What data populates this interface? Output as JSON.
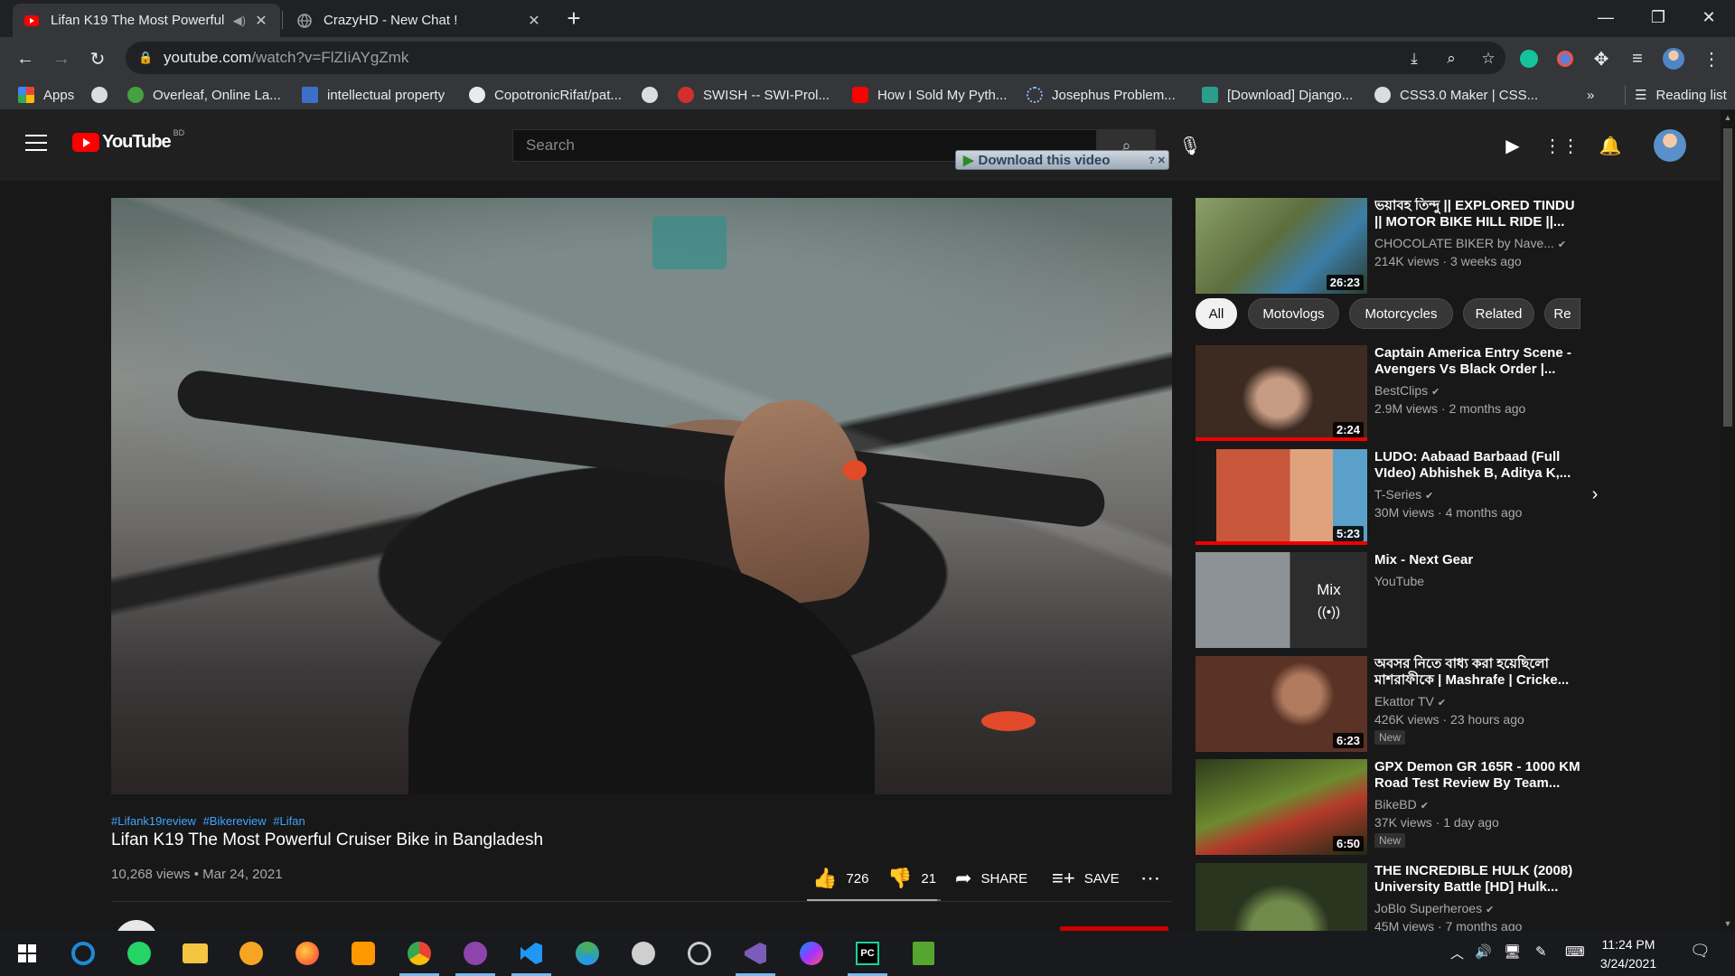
{
  "browser": {
    "tabs": [
      {
        "title": "Lifan K19 The Most Powerful",
        "active": true,
        "favicon": "youtube-icon"
      },
      {
        "title": "CrazyHD - New Chat !",
        "active": false,
        "favicon": "globe-icon"
      }
    ],
    "url_host": "youtube.com",
    "url_path": "/watch?v=FlZIiAYgZmk",
    "bookmarks": [
      {
        "label": "Apps",
        "icon": "apps-grid-icon",
        "color": "#4285f4"
      },
      {
        "label": "",
        "icon": "globe-icon",
        "color": "#9aa0a6"
      },
      {
        "label": "Overleaf, Online La...",
        "icon": "overleaf-icon",
        "color": "#47a141"
      },
      {
        "label": "intellectual property",
        "icon": "document-icon",
        "color": "#3b6fc9"
      },
      {
        "label": "CopotronicRifat/pat...",
        "icon": "github-icon",
        "color": "#e8eaed"
      },
      {
        "label": "",
        "icon": "globe-icon",
        "color": "#9aa0a6"
      },
      {
        "label": "SWISH -- SWI-Prol...",
        "icon": "swish-icon",
        "color": "#d32f2f"
      },
      {
        "label": "How I Sold My Pyth...",
        "icon": "youtube-icon",
        "color": "#ff0000"
      },
      {
        "label": "Josephus Problem...",
        "icon": "loading-icon",
        "color": "#8ab4f8"
      },
      {
        "label": "[Download] Django...",
        "icon": "django-icon",
        "color": "#2a9d8f"
      },
      {
        "label": "CSS3.0 Maker | CSS...",
        "icon": "globe-icon",
        "color": "#9aa0a6"
      }
    ],
    "reading_list": "Reading list"
  },
  "youtube": {
    "logo_text": "YouTube",
    "region": "BD",
    "search_placeholder": "Search",
    "download_label": "Download this video",
    "video": {
      "hashtags": [
        "#Lifank19review",
        "#Bikereview",
        "#Lifan"
      ],
      "title": "Lifan K19 The Most Powerful Cruiser Bike in Bangladesh",
      "views": "10,268 views",
      "date": "Mar 24, 2021",
      "likes": "726",
      "dislikes": "21",
      "like_ratio": 0.97,
      "share": "SHARE",
      "save": "SAVE"
    },
    "chips": [
      "All",
      "Motovlogs",
      "Motorcycles",
      "Related",
      "Re"
    ],
    "recommendations": [
      {
        "title": "ভয়াবহ তিন্দু || EXPLORED TINDU || MOTOR BIKE HILL RIDE ||...",
        "channel": "CHOCOLATE BIKER by Nave...",
        "verified": true,
        "views": "214K views · 3 weeks ago",
        "duration": "26:23",
        "new": false,
        "thumb_color": "#6c7a4c"
      },
      {
        "title": "Captain America Entry Scene - Avengers Vs Black Order |...",
        "channel": "BestClips",
        "verified": true,
        "views": "2.9M views · 2 months ago",
        "duration": "2:24",
        "new": false,
        "thumb_color": "#4a4a45"
      },
      {
        "title": "LUDO: Aabaad Barbaad (Full VIdeo) Abhishek B, Aditya K,...",
        "channel": "T-Series",
        "verified": true,
        "views": "30M views · 4 months ago",
        "duration": "5:23",
        "new": false,
        "thumb_color": "#b4563a"
      },
      {
        "title": "Mix - Next Gear",
        "channel": "YouTube",
        "verified": false,
        "views": "",
        "duration": "",
        "new": false,
        "mix_label": "Mix",
        "thumb_color": "#7a7f83"
      },
      {
        "title": "অবসর নিতে বাধ্য করা হয়েছিলো মাশরাফীকে | Mashrafe | Cricke...",
        "channel": "Ekattor TV",
        "verified": true,
        "views": "426K views · 23 hours ago",
        "duration": "6:23",
        "new": true,
        "thumb_color": "#9b6d57"
      },
      {
        "title": "GPX Demon GR 165R - 1000 KM Road Test Review By Team...",
        "channel": "BikeBD",
        "verified": true,
        "views": "37K views · 1 day ago",
        "duration": "6:50",
        "new": true,
        "thumb_color": "#5b7b2f"
      },
      {
        "title": "THE INCREDIBLE HULK (2008) University Battle [HD] Hulk...",
        "channel": "JoBlo Superheroes",
        "verified": true,
        "views": "45M views · 7 months ago",
        "duration": "",
        "new": false,
        "thumb_color": "#566a3f"
      }
    ],
    "new_badge": "New"
  },
  "taskbar": {
    "time": "11:24 PM",
    "date": "3/24/2021",
    "apps": [
      {
        "name": "start-icon",
        "color": "#ffffff"
      },
      {
        "name": "cortana-icon",
        "color": "#1f8ad6"
      },
      {
        "name": "whatsapp-icon",
        "color": "#25d366"
      },
      {
        "name": "file-explorer-icon",
        "color": "#f4c542"
      },
      {
        "name": "brave-icon",
        "color": "#f7a425"
      },
      {
        "name": "firefox-icon",
        "color": "#ff7139"
      },
      {
        "name": "sublime-icon",
        "color": "#ff9800"
      },
      {
        "name": "chrome-icon",
        "color": "#4caf50"
      },
      {
        "name": "github-desktop-icon",
        "color": "#8e44ad"
      },
      {
        "name": "vscode-icon",
        "color": "#2196f3"
      },
      {
        "name": "edge-icon",
        "color": "#4caf50"
      },
      {
        "name": "satellite-icon",
        "color": "#e0e0e0"
      },
      {
        "name": "eclipse-icon",
        "color": "#cccccc"
      },
      {
        "name": "visual-studio-icon",
        "color": "#7b5cb9"
      },
      {
        "name": "messenger-icon",
        "color": "#7a5cff"
      },
      {
        "name": "pycharm-icon",
        "color": "#1fd195"
      },
      {
        "name": "notepad-icon",
        "color": "#55a630"
      }
    ]
  }
}
